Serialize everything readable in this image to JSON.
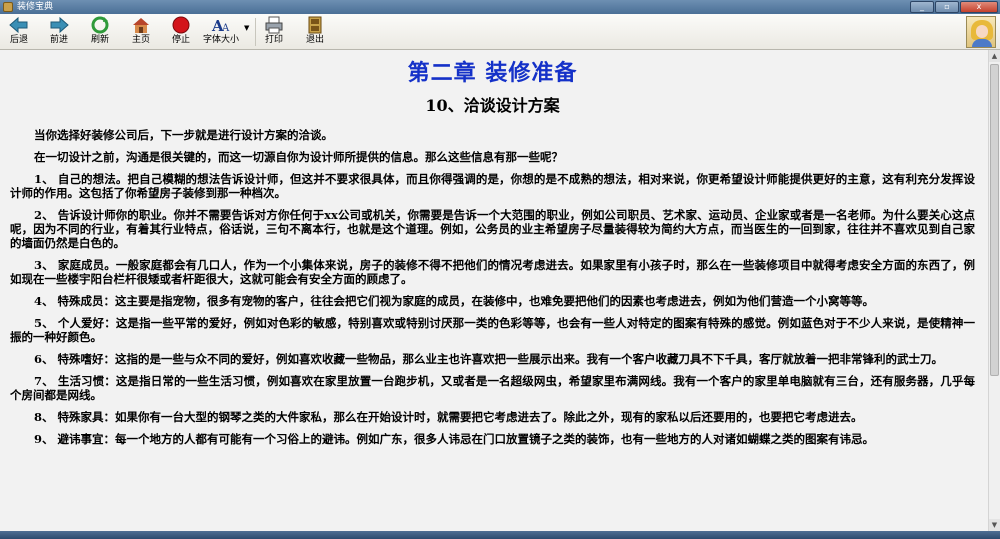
{
  "window": {
    "title": "装修宝典"
  },
  "toolbar": {
    "items": [
      {
        "label": "后退",
        "icon": "back-arrow-icon"
      },
      {
        "label": "前进",
        "icon": "forward-arrow-icon"
      },
      {
        "label": "刷新",
        "icon": "refresh-icon"
      },
      {
        "label": "主页",
        "icon": "home-icon"
      },
      {
        "label": "停止",
        "icon": "stop-icon"
      },
      {
        "label": "字体大小",
        "icon": "font-size-icon"
      },
      {
        "label": "打印",
        "icon": "print-icon"
      },
      {
        "label": "退出",
        "icon": "exit-door-icon"
      }
    ]
  },
  "document": {
    "chapter_title": "第二章 装修准备",
    "section_title": "10、洽谈设计方案",
    "paragraphs": [
      "当你选择好装修公司后，下一步就是进行设计方案的洽谈。",
      "在一切设计之前，沟通是很关键的，而这一切源自你为设计师所提供的信息。那么这些信息有那一些呢？",
      "1、 自己的想法。把自己模糊的想法告诉设计师，但这并不要求很具体，而且你得强调的是，你想的是不成熟的想法，相对来说，你更希望设计师能提供更好的主意，这有利充分发挥设计师的作用。这包括了你希望房子装修到那一种档次。",
      "2、 告诉设计师你的职业。你并不需要告诉对方你任何于xx公司或机关，你需要是告诉一个大范围的职业，例如公司职员、艺术家、运动员、企业家或者是一名老师。为什么要关心这点呢，因为不同的行业，有着其行业特点，俗话说，三句不离本行，也就是这个道理。例如，公务员的业主希望房子尽量装得较为简约大方点，而当医生的一回到家，往往并不喜欢见到自己家的墙面仍然是白色的。",
      "3、 家庭成员。一般家庭都会有几口人，作为一个小集体来说，房子的装修不得不把他们的情况考虑进去。如果家里有小孩子时，那么在一些装修项目中就得考虑安全方面的东西了，例如现在一些楼宇阳台栏杆很矮或者杆距很大，这就可能会有安全方面的顾虑了。",
      "4、 特殊成员：这主要是指宠物，很多有宠物的客户，往往会把它们视为家庭的成员，在装修中，也难免要把他们的因素也考虑进去，例如为他们营造一个小窝等等。",
      "5、 个人爱好：这是指一些平常的爱好，例如对色彩的敏感，特别喜欢或特别讨厌那一类的色彩等等，也会有一些人对特定的图案有特殊的感觉。例如蓝色对于不少人来说，是使精神一振的一种好颜色。",
      "6、 特殊嗜好：这指的是一些与众不同的爱好，例如喜欢收藏一些物品，那么业主也许喜欢把一些展示出来。我有一个客户收藏刀具不下千具，客厅就放着一把非常锋利的武士刀。",
      "7、 生活习惯：这是指日常的一些生活习惯，例如喜欢在家里放置一台跑步机，又或者是一名超级网虫，希望家里布满网线。我有一个客户的家里单电脑就有三台，还有服务器，几乎每个房间都是网线。",
      "8、 特殊家具：如果你有一台大型的钢琴之类的大件家私，那么在开始设计时，就需要把它考虑进去了。除此之外，现有的家私以后还要用的，也要把它考虑进去。",
      "9、 避讳事宜：每一个地方的人都有可能有一个习俗上的避讳。例如广东，很多人讳忌在门口放置镜子之类的装饰，也有一些地方的人对诸如蝴蝶之类的图案有讳忌。"
    ]
  },
  "colors": {
    "chapter_title": "#1431c8",
    "content_bg": "#f2f2f2",
    "toolbar_bg": "#efede6"
  }
}
